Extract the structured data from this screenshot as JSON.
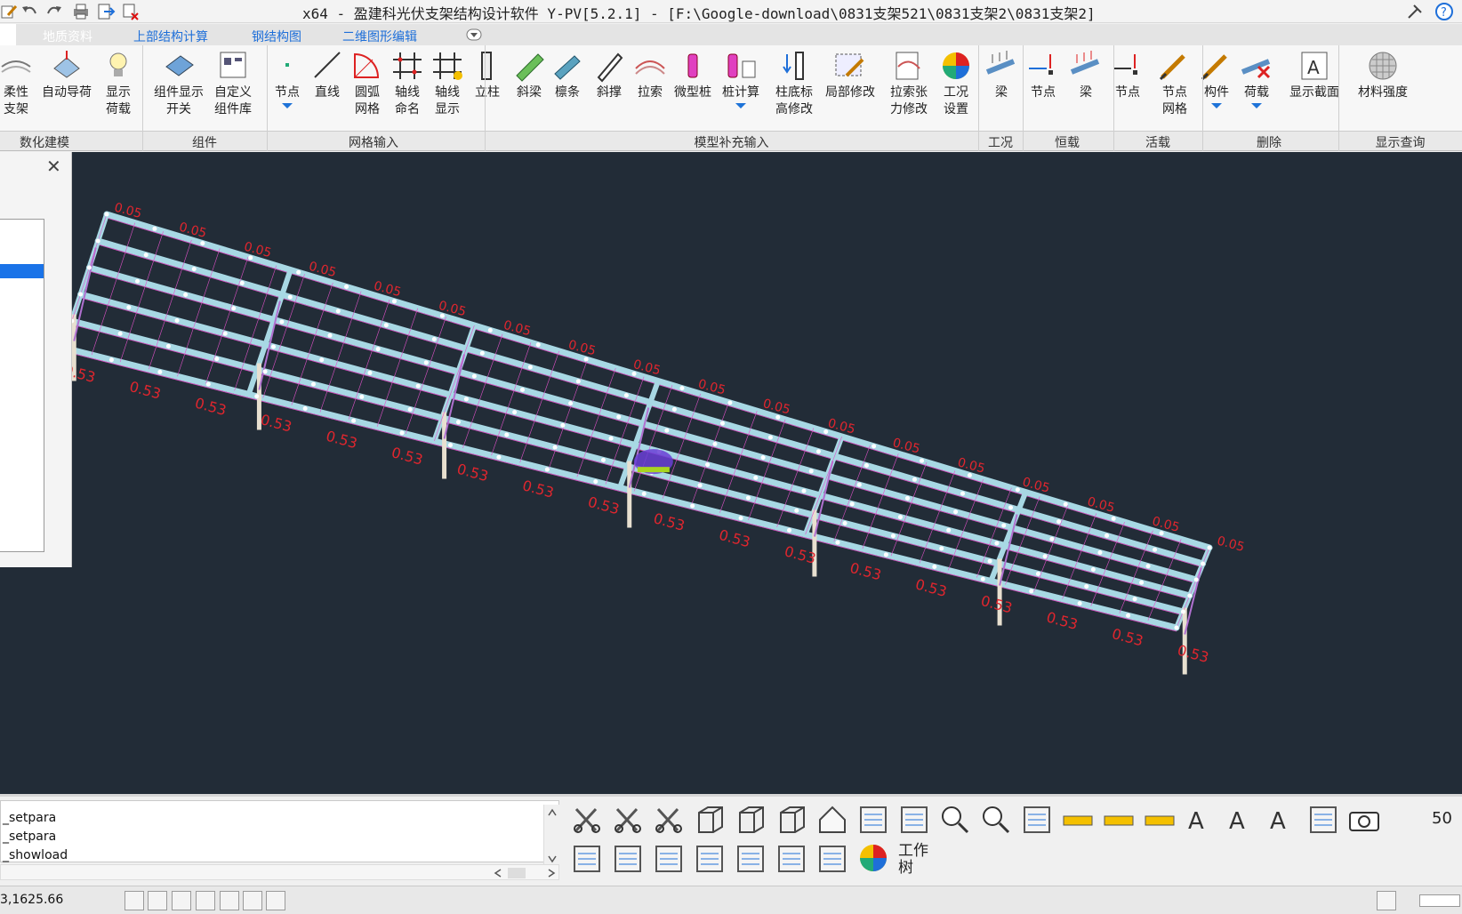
{
  "window": {
    "title": "x64 - 盈建科光伏支架结构设计软件 Y-PV[5.2.1] - [F:\\Google-download\\0831支架521\\0831支架2\\0831支架2]"
  },
  "quick_access": [
    "edit-icon",
    "undo-icon",
    "redo-icon",
    "print-icon",
    "export-icon",
    "close-doc-icon"
  ],
  "window_controls": [
    "pin-icon",
    "help-icon"
  ],
  "tabs": [
    {
      "label": "地质资料",
      "color": "#ffffff"
    },
    {
      "label": "上部结构计算",
      "color": "#1e6fd9"
    },
    {
      "label": "钢结构图",
      "color": "#1e6fd9"
    },
    {
      "label": "二维图形编辑",
      "color": "#1e6fd9"
    }
  ],
  "ribbon": {
    "buttons": [
      {
        "label": "柔性\n支架",
        "icon": "flexible-support-icon"
      },
      {
        "label": "自动导荷",
        "icon": "auto-load-icon"
      },
      {
        "label": "显示\n荷载",
        "icon": "lightbulb-icon"
      },
      {
        "label": "组件显示\n开关",
        "icon": "module-toggle-icon"
      },
      {
        "label": "自定义\n组件库",
        "icon": "custom-library-icon"
      },
      {
        "label": "节点",
        "icon": "node-icon"
      },
      {
        "label": "直线",
        "icon": "line-icon"
      },
      {
        "label": "圆弧\n网格",
        "icon": "arc-grid-icon"
      },
      {
        "label": "轴线\n命名",
        "icon": "axis-name-icon"
      },
      {
        "label": "轴线\n显示",
        "icon": "axis-display-icon"
      },
      {
        "label": "立柱",
        "icon": "column-icon"
      },
      {
        "label": "斜梁",
        "icon": "inclined-beam-icon"
      },
      {
        "label": "檩条",
        "icon": "purlin-icon"
      },
      {
        "label": "斜撑",
        "icon": "brace-icon"
      },
      {
        "label": "拉索",
        "icon": "cable-icon"
      },
      {
        "label": "微型桩",
        "icon": "micro-pile-icon"
      },
      {
        "label": "桩计算",
        "icon": "pile-calc-icon"
      },
      {
        "label": "柱底标\n高修改",
        "icon": "base-elevation-icon"
      },
      {
        "label": "局部修改",
        "icon": "local-edit-icon"
      },
      {
        "label": "拉索张\n力修改",
        "icon": "cable-tension-icon"
      },
      {
        "label": "工况\n设置",
        "icon": "load-case-icon"
      },
      {
        "label": "梁",
        "icon": "dead-beam-icon"
      },
      {
        "label": "节点",
        "icon": "dead-node-icon"
      },
      {
        "label": "梁",
        "icon": "live-beam-icon"
      },
      {
        "label": "节点",
        "icon": "live-node-icon"
      },
      {
        "label": "节点\n网格",
        "icon": "delete-node-grid-icon"
      },
      {
        "label": "构件",
        "icon": "delete-member-icon"
      },
      {
        "label": "荷载",
        "icon": "delete-load-icon"
      },
      {
        "label": "显示截面",
        "icon": "show-section-icon"
      },
      {
        "label": "材料强度",
        "icon": "material-strength-icon"
      }
    ],
    "groups": [
      "数化建模",
      "组件",
      "网格输入",
      "模型补充输入",
      "工况",
      "恒载",
      "活载",
      "删除",
      "显示查询"
    ]
  },
  "model": {
    "load_labels": {
      "column": "0.53",
      "purlin": "0.05",
      "span": "0.53"
    }
  },
  "command_window": {
    "lines": [
      "_setpara",
      "_setpara",
      "_showload"
    ]
  },
  "toolbar2_icons": [
    "cut-x-icon",
    "cut-y-icon",
    "cut-z-icon",
    "view-front-icon",
    "view-side-icon",
    "view-iso-icon",
    "home-view-icon",
    "rotate-view-icon",
    "pan-icon",
    "zoom-extents-icon",
    "zoom-icon",
    "render-icon",
    "measure-icon",
    "ruler-icon",
    "angle-icon",
    "text-style-icon",
    "text-find-icon",
    "text-edit-icon",
    "settings-icon",
    "camera-icon",
    "building-icon",
    "layout-icon",
    "delete-window-icon",
    "select-icon",
    "annotation-icon",
    "list-icon",
    "model-icon",
    "color-wheel-icon"
  ],
  "toolbar2_text": {
    "work_tree": "工作\n树",
    "scale": "50"
  },
  "status": {
    "coords": "3,1625.66"
  }
}
